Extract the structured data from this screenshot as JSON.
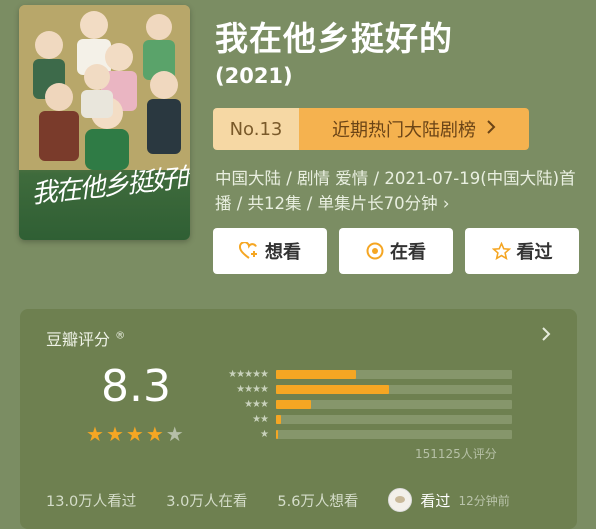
{
  "poster": {
    "calligraphy": "我在他乡挺好的"
  },
  "header": {
    "title": "我在他乡挺好的",
    "year": "(2021)"
  },
  "rank": {
    "number": "No.13",
    "list_name": "近期热门大陆剧榜",
    "arrow_icon": "chevron-right-icon"
  },
  "meta": {
    "info": "中国大陆 / 剧情 爱情 / 2021-07-19(中国大陆)首播 / 共12集 / 单集片长70分钟 ›"
  },
  "actions": [
    {
      "label": "想看",
      "icon": "heart-plus-icon"
    },
    {
      "label": "在看",
      "icon": "circle-dot-icon"
    },
    {
      "label": "看过",
      "icon": "star-outline-icon"
    }
  ],
  "rating": {
    "title": "豆瓣评分",
    "reg_mark": "®",
    "score": "8.3",
    "stars": 4,
    "star_max": 5,
    "distribution": [
      {
        "stars": 5,
        "fraction": 0.34
      },
      {
        "stars": 4,
        "fraction": 0.48
      },
      {
        "stars": 3,
        "fraction": 0.15
      },
      {
        "stars": 2,
        "fraction": 0.02
      },
      {
        "stars": 1,
        "fraction": 0.01
      }
    ],
    "count": "151125人评分"
  },
  "stats": {
    "watched": "13.0万人看过",
    "watching": "3.0万人在看",
    "want": "5.6万人想看",
    "friend_status": "看过",
    "time_ago": "12分钟前"
  },
  "colors": {
    "background": "#7b8d63",
    "accent": "#f5a623",
    "panel": "#6e8050"
  }
}
